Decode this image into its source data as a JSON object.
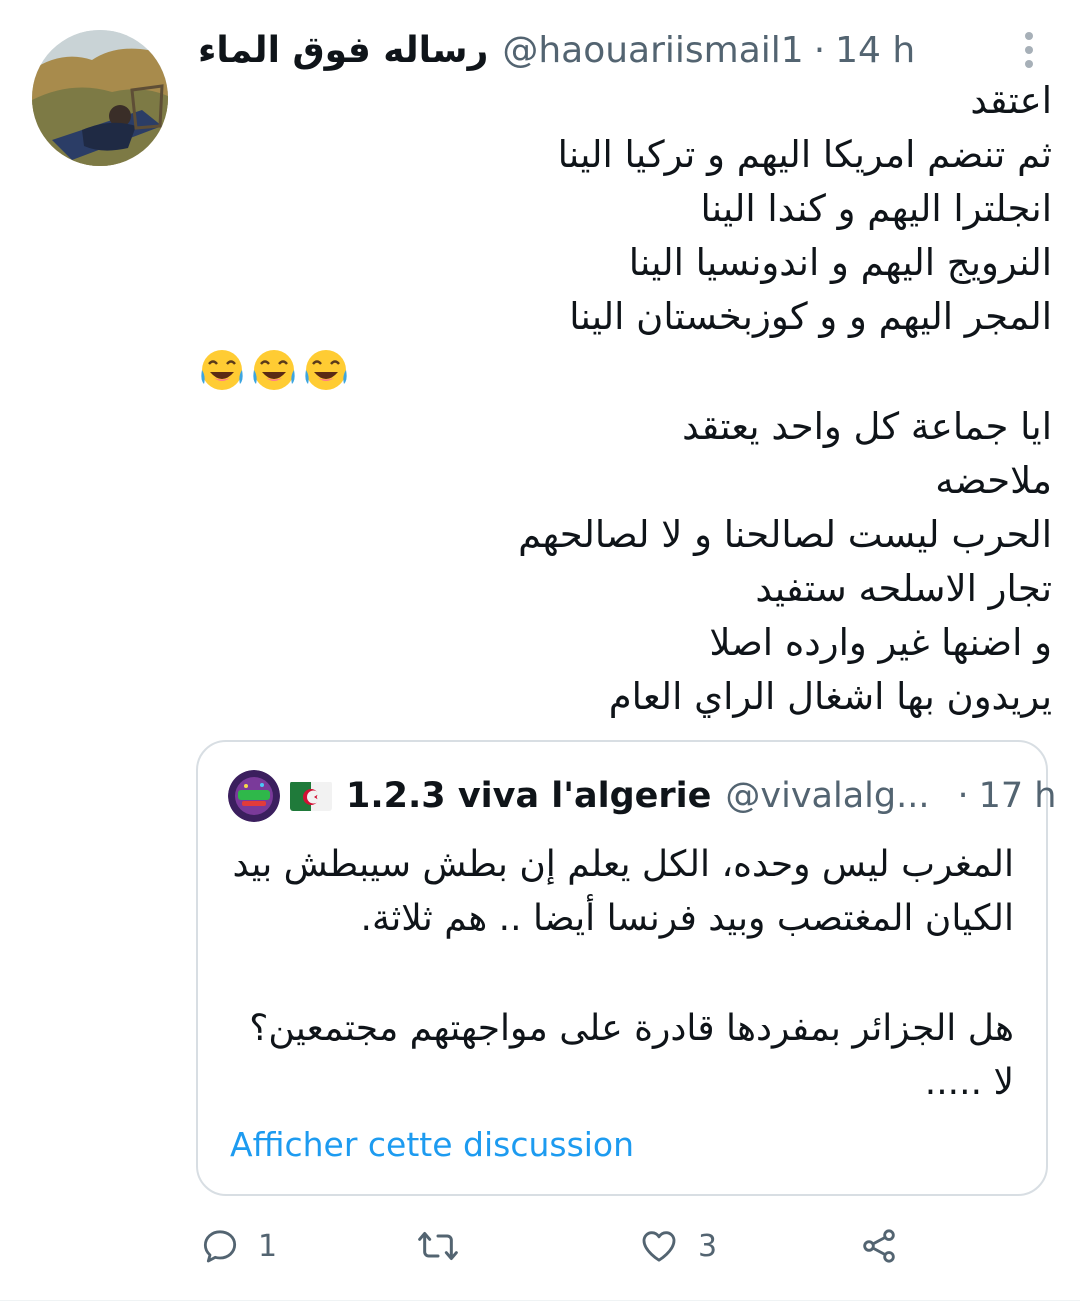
{
  "tweet": {
    "display_name": "رساله فوق الماء",
    "handle": "@haouariismail1",
    "separator": "·",
    "time": "14 h",
    "body_lines": [
      "اعتقد",
      "ثم تنضم امريكا اليهم و تركيا الينا",
      "انجلترا اليهم و كندا الينا",
      "النرويج اليهم و اندونسيا الينا",
      "المجر اليهم و و كوزبخستان الينا"
    ],
    "emoji_icons": [
      "face-with-tears-of-joy-icon",
      "face-with-tears-of-joy-icon",
      "face-with-tears-of-joy-icon"
    ],
    "body_lines_2": [
      "ايا جماعة كل واحد يعتقد",
      "ملاحضه",
      "الحرب ليست لصالحنا و لا لصالحهم",
      "تجار الاسلحه ستفيد",
      "و اضنها غير وارده اصلا",
      "يريدون بها اشغال الراي العام"
    ]
  },
  "quote": {
    "name": "1.2.3 viva l'algerie",
    "handle": "@vivalalg...",
    "separator": "·",
    "time": "17 h",
    "flag_icon": "algeria-flag-icon",
    "lines": [
      "المغرب ليس وحده، الكل يعلم إن بطش سيبطش بيد",
      "الكيان المغتصب وبيد فرنسا أيضا .. هم ثلاثة.",
      "هل الجزائر بمفردها قادرة على مواجهتهم مجتمعين؟",
      "لا ....."
    ],
    "show_thread": "Afficher cette discussion"
  },
  "actions": {
    "reply_count": "1",
    "retweet_count": "",
    "like_count": "3"
  },
  "colors": {
    "text": "#0f1419",
    "secondary": "#536471",
    "link": "#1d9bf0",
    "border": "#d8dee3"
  }
}
